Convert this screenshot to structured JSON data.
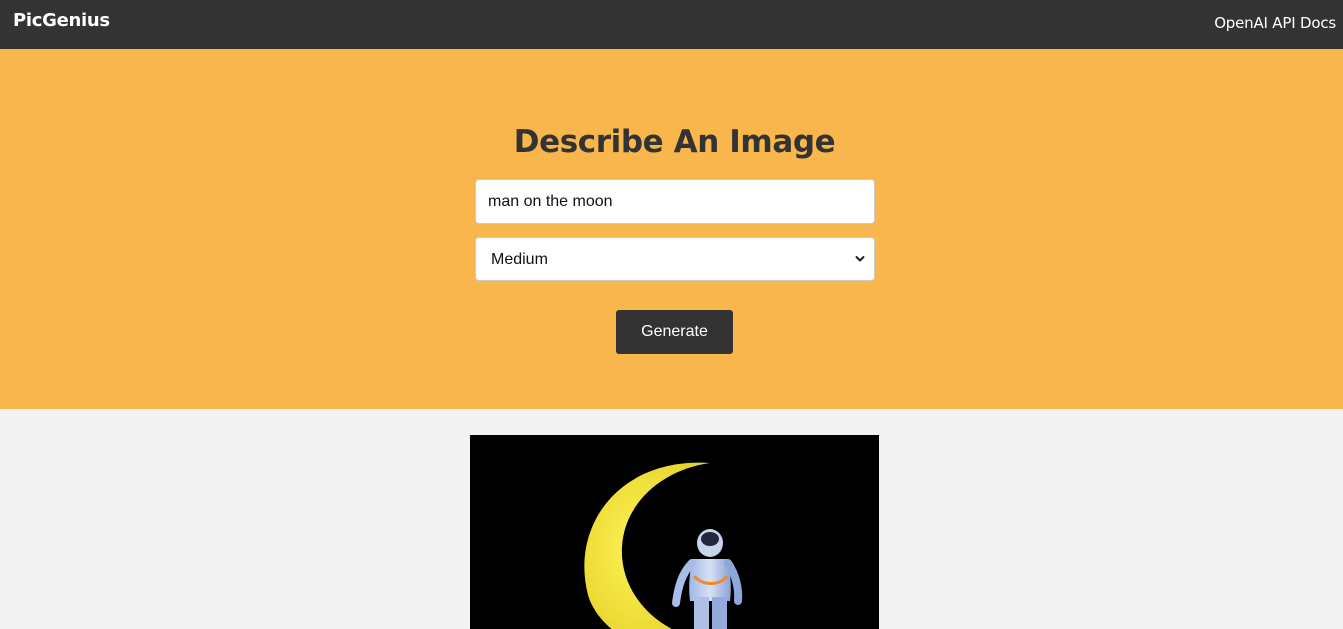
{
  "navbar": {
    "logo": "PicGenius",
    "link_label": "OpenAI API Docs"
  },
  "hero": {
    "title": "Describe An Image",
    "prompt_value": "man on the moon",
    "size_selected": "Medium",
    "generate_label": "Generate"
  },
  "colors": {
    "navbar_bg": "#333333",
    "hero_bg": "#f8b64c",
    "page_bg": "#f3f3f3",
    "button_bg": "#333333",
    "moon": "#f5e33a"
  },
  "icons": {
    "select_arrow": "chevron-down-icon"
  }
}
